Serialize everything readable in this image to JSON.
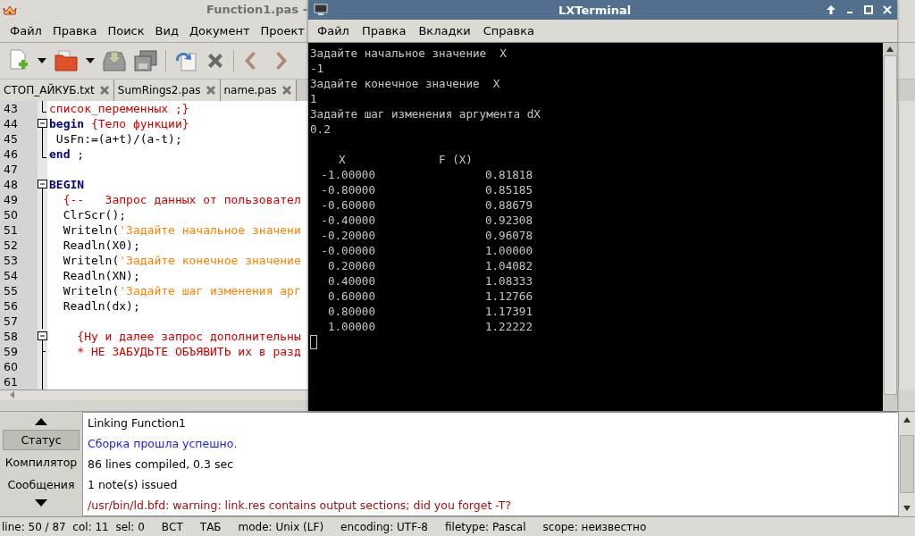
{
  "editor": {
    "title": "Function1.pas -",
    "menu": [
      "Файл",
      "Правка",
      "Поиск",
      "Вид",
      "Документ",
      "Проект"
    ],
    "tabs": [
      {
        "label": "СТОП_АЙКУБ.txt",
        "selected": false
      },
      {
        "label": "SumRings2.pas",
        "selected": false
      },
      {
        "label": "name.pas",
        "selected": false
      }
    ],
    "lines": [
      {
        "number": "43",
        "kind": "fold-end",
        "segments": [
          {
            "text": "список_переменных ;}",
            "kind": "comment"
          }
        ]
      },
      {
        "number": "44",
        "kind": "fold-start",
        "segments": [
          {
            "text": "begin",
            "kind": "keyword"
          },
          {
            "text": " {Тело функции}",
            "kind": "comment"
          }
        ]
      },
      {
        "number": "45",
        "kind": "fold-body",
        "segments": [
          {
            "text": " UsFn:=(a+t)/(a-t);",
            "kind": "plain"
          }
        ]
      },
      {
        "number": "46",
        "kind": "fold-end",
        "segments": [
          {
            "text": "end",
            "kind": "keyword"
          },
          {
            "text": " ;",
            "kind": "plain"
          }
        ]
      },
      {
        "number": "47",
        "kind": "plain"
      },
      {
        "number": "48",
        "kind": "fold-start",
        "segments": [
          {
            "text": "BEGIN",
            "kind": "keyword"
          }
        ]
      },
      {
        "number": "49",
        "kind": "fold-body",
        "segments": [
          {
            "text": "  {--   Запрос данных от пользовател",
            "kind": "comment"
          }
        ]
      },
      {
        "number": "50",
        "kind": "fold-body",
        "segments": [
          {
            "text": "  ClrScr();",
            "kind": "plain"
          }
        ]
      },
      {
        "number": "51",
        "kind": "fold-body",
        "segments": [
          {
            "text": "  Writeln(",
            "kind": "plain"
          },
          {
            "text": "'Задайте начальное значени",
            "kind": "string"
          }
        ]
      },
      {
        "number": "52",
        "kind": "fold-body",
        "segments": [
          {
            "text": "  Readln(X0);",
            "kind": "plain"
          }
        ]
      },
      {
        "number": "53",
        "kind": "fold-body",
        "segments": [
          {
            "text": "  Writeln(",
            "kind": "plain"
          },
          {
            "text": "'Задайте конечное значение",
            "kind": "string"
          }
        ]
      },
      {
        "number": "54",
        "kind": "fold-body",
        "segments": [
          {
            "text": "  Readln(XN);",
            "kind": "plain"
          }
        ]
      },
      {
        "number": "55",
        "kind": "fold-body",
        "segments": [
          {
            "text": "  Writeln(",
            "kind": "plain"
          },
          {
            "text": "'Задайте шаг изменения арг",
            "kind": "string"
          }
        ]
      },
      {
        "number": "56",
        "kind": "fold-body",
        "segments": [
          {
            "text": "  Readln(dx);",
            "kind": "plain"
          }
        ]
      },
      {
        "number": "57",
        "kind": "fold-body"
      },
      {
        "number": "58",
        "kind": "fold-start",
        "segments": [
          {
            "text": "    {Ну и далее запрос дополнительны",
            "kind": "comment"
          }
        ]
      },
      {
        "number": "59",
        "kind": "fold-branch",
        "segments": [
          {
            "text": "    * НЕ ЗАБУДЬТЕ ОБЪЯВИТЬ их в разд",
            "kind": "comment"
          }
        ]
      },
      {
        "number": "60",
        "kind": "fold-body"
      },
      {
        "number": "61",
        "kind": "fold-body"
      }
    ]
  },
  "messages_panel": {
    "tabs": [
      {
        "label": "Статус",
        "selected": true
      },
      {
        "label": "Компилятор",
        "selected": false
      },
      {
        "label": "Сообщения",
        "selected": false
      }
    ],
    "messages": [
      {
        "text": "Linking Function1",
        "color": "#000000"
      },
      {
        "text": "Сборка прошла успешно.",
        "color": "#1a1ae6"
      },
      {
        "text": "86 lines compiled, 0.3 sec",
        "color": "#000000"
      },
      {
        "text": "1 note(s) issued",
        "color": "#000000"
      },
      {
        "text": "/usr/bin/ld.bfd: warning: link.res contains output sections; did you forget -T?",
        "color": "#a01010"
      }
    ]
  },
  "status_bar": [
    "line: 50 / 87  col: 11  sel: 0",
    "ВСТ",
    "ТАБ",
    "mode: Unix (LF)",
    "encoding: UTF-8",
    "filetype: Pascal",
    "scope: неизвестно"
  ],
  "terminal": {
    "title": "LXTerminal",
    "menu": [
      "Файл",
      "Правка",
      "Вкладки",
      "Справка"
    ],
    "prompt_lines": [
      "Задайте начальное значение  X",
      "-1",
      "Задайте конечное значение  X",
      "1",
      "Задайте шаг изменения аргумента dX",
      "0.2"
    ],
    "table": {
      "header": [
        "X",
        "F (X)"
      ],
      "rows": [
        [
          "-1.00000",
          "0.81818"
        ],
        [
          "-0.80000",
          "0.85185"
        ],
        [
          "-0.60000",
          "0.88679"
        ],
        [
          "-0.40000",
          "0.92308"
        ],
        [
          "-0.20000",
          "0.96078"
        ],
        [
          "-0.00000",
          "1.00000"
        ],
        [
          "0.20000",
          "1.04082"
        ],
        [
          "0.40000",
          "1.08333"
        ],
        [
          "0.60000",
          "1.12766"
        ],
        [
          "0.80000",
          "1.17391"
        ],
        [
          "1.00000",
          "1.22222"
        ]
      ]
    }
  }
}
